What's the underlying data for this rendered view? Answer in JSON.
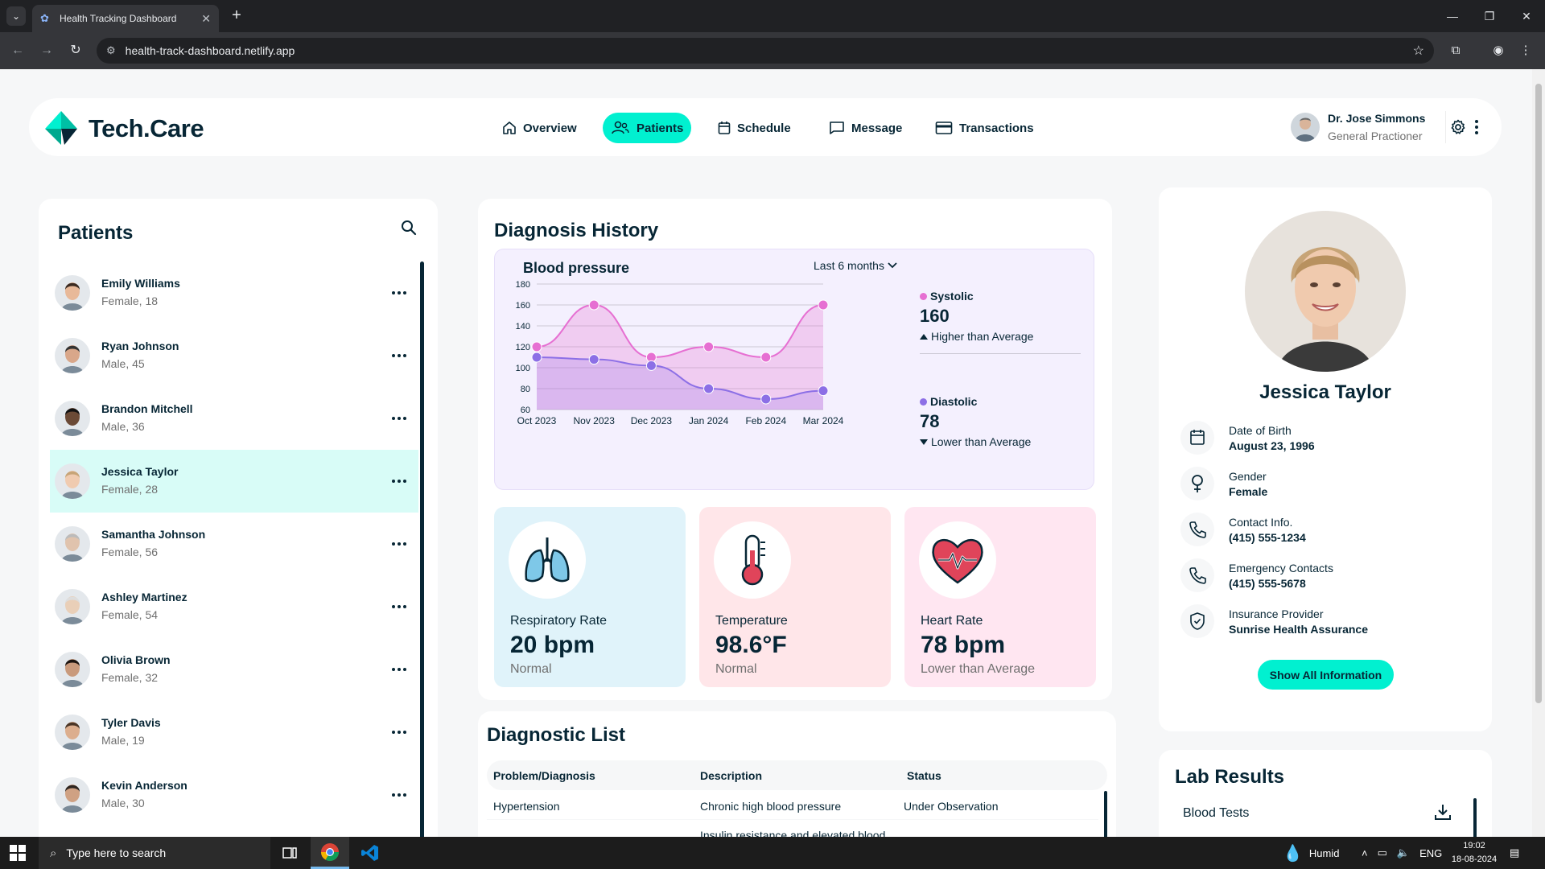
{
  "browser": {
    "tab_title": "Health Tracking Dashboard",
    "url": "health-track-dashboard.netlify.app"
  },
  "brand": {
    "name": "Tech.Care",
    "accent": "#01f0d0",
    "text_color": "#072635"
  },
  "nav": [
    {
      "label": "Overview",
      "icon": "home-icon"
    },
    {
      "label": "Patients",
      "icon": "group-icon",
      "active": true
    },
    {
      "label": "Schedule",
      "icon": "calendar-icon"
    },
    {
      "label": "Message",
      "icon": "chat-icon"
    },
    {
      "label": "Transactions",
      "icon": "credit-card-icon"
    }
  ],
  "doctor": {
    "name": "Dr. Jose Simmons",
    "role": "General Practioner"
  },
  "patients": {
    "title": "Patients",
    "items": [
      {
        "name": "Emily Williams",
        "info": "Female, 18"
      },
      {
        "name": "Ryan Johnson",
        "info": "Male, 45"
      },
      {
        "name": "Brandon Mitchell",
        "info": "Male, 36"
      },
      {
        "name": "Jessica Taylor",
        "info": "Female, 28",
        "selected": true
      },
      {
        "name": "Samantha Johnson",
        "info": "Female, 56"
      },
      {
        "name": "Ashley Martinez",
        "info": "Female, 54"
      },
      {
        "name": "Olivia Brown",
        "info": "Female, 32"
      },
      {
        "name": "Tyler Davis",
        "info": "Male, 19"
      },
      {
        "name": "Kevin Anderson",
        "info": "Male, 30"
      }
    ]
  },
  "diagnosis": {
    "title": "Diagnosis History",
    "chart_title": "Blood pressure",
    "range_label": "Last 6 months",
    "systolic": {
      "label": "Systolic",
      "value": "160",
      "note": "Higher than Average",
      "color": "#e66fd2"
    },
    "diastolic": {
      "label": "Diastolic",
      "value": "78",
      "note": "Lower than Average",
      "color": "#8c6fe6"
    }
  },
  "chart_data": {
    "type": "line",
    "title": "Blood pressure",
    "categories": [
      "Oct 2023",
      "Nov 2023",
      "Dec 2023",
      "Jan 2024",
      "Feb 2024",
      "Mar 2024"
    ],
    "series": [
      {
        "name": "Systolic",
        "values": [
          120,
          160,
          110,
          120,
          110,
          160
        ]
      },
      {
        "name": "Diastolic",
        "values": [
          110,
          108,
          102,
          80,
          70,
          78
        ]
      }
    ],
    "y_ticks": [
      60,
      80,
      100,
      120,
      140,
      160,
      180
    ],
    "ylim": [
      60,
      180
    ],
    "grid": true,
    "legend": "right"
  },
  "vitals": [
    {
      "label": "Respiratory Rate",
      "value": "20 bpm",
      "note": "Normal",
      "color": "#e0f3fa",
      "icon": "lungs-icon"
    },
    {
      "label": "Temperature",
      "value": "98.6°F",
      "note": "Normal",
      "color": "#ffe6e9",
      "icon": "thermometer-icon"
    },
    {
      "label": "Heart Rate",
      "value": "78 bpm",
      "note": "Lower than Average",
      "color": "#ffe6f1",
      "icon": "heart-rate-icon"
    }
  ],
  "diagnostic_list": {
    "title": "Diagnostic List",
    "headers": [
      "Problem/Diagnosis",
      "Description",
      "Status"
    ],
    "rows": [
      [
        "Hypertension",
        "Chronic high blood pressure",
        "Under Observation"
      ],
      [
        "",
        "Insulin resistance and elevated blood",
        ""
      ]
    ]
  },
  "profile": {
    "name": "Jessica Taylor",
    "fields": [
      {
        "label": "Date of Birth",
        "value": "August 23, 1996",
        "icon": "calendar-icon"
      },
      {
        "label": "Gender",
        "value": "Female",
        "icon": "female-icon"
      },
      {
        "label": "Contact Info.",
        "value": "(415) 555-1234",
        "icon": "phone-icon"
      },
      {
        "label": "Emergency Contacts",
        "value": "(415) 555-5678",
        "icon": "phone-icon"
      },
      {
        "label": "Insurance Provider",
        "value": "Sunrise Health Assurance",
        "icon": "shield-icon"
      }
    ],
    "button": "Show All Information"
  },
  "lab": {
    "title": "Lab Results",
    "items": [
      "Blood Tests"
    ]
  },
  "taskbar": {
    "search_placeholder": "Type here to search",
    "weather": "Humid",
    "lang": "ENG",
    "time": "19:02",
    "date": "18-08-2024"
  }
}
